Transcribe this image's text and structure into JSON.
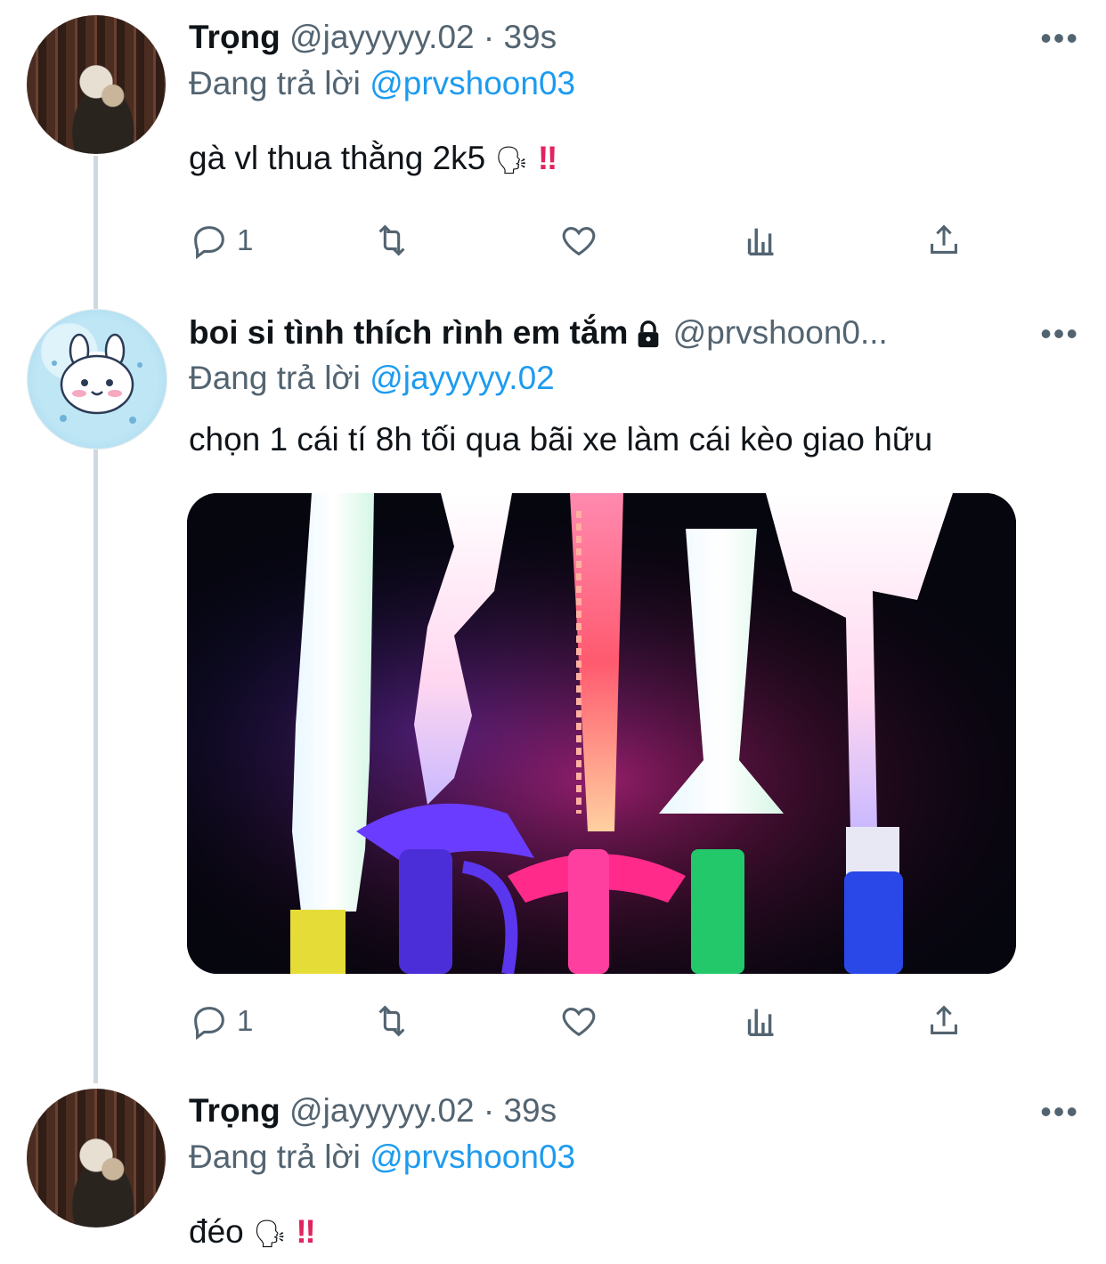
{
  "tweets": [
    {
      "name": "Trọng",
      "handle": "@jayyyyy.02",
      "time": "39s",
      "sep": "·",
      "reply_prefix": "Đang trả lời",
      "reply_to": "@prvshoon03",
      "text": "gà vl thua thằng 2k5",
      "emoji": "🗣",
      "bang": "‼",
      "reply_count": "1",
      "avatar": "avatar-photo"
    },
    {
      "name": "boi si tình thích rình em tắm",
      "handle": "@prvshoon0...",
      "reply_prefix": "Đang trả lời",
      "reply_to": "@jayyyyy.02",
      "text": "chọn 1 cái tí 8h tối qua bãi xe làm cái kèo giao hữu",
      "reply_count": "1",
      "avatar": "avatar-cute",
      "locked": true
    },
    {
      "name": "Trọng",
      "handle": "@jayyyyy.02",
      "time": "39s",
      "sep": "·",
      "reply_prefix": "Đang trả lời",
      "reply_to": "@prvshoon03",
      "text": "đéo",
      "emoji": "🗣",
      "bang": "‼",
      "avatar": "avatar-photo"
    }
  ],
  "more_label": "•••",
  "media": {
    "subject": "five glowing LED toy swords",
    "colors": [
      "#f5e9a0",
      "#ff4f9a",
      "#7a4dff",
      "#2ee07a",
      "#3a6bff"
    ]
  },
  "icons": [
    "reply-icon",
    "retweet-icon",
    "like-icon",
    "views-icon",
    "share-icon",
    "lock-icon",
    "more-icon"
  ]
}
